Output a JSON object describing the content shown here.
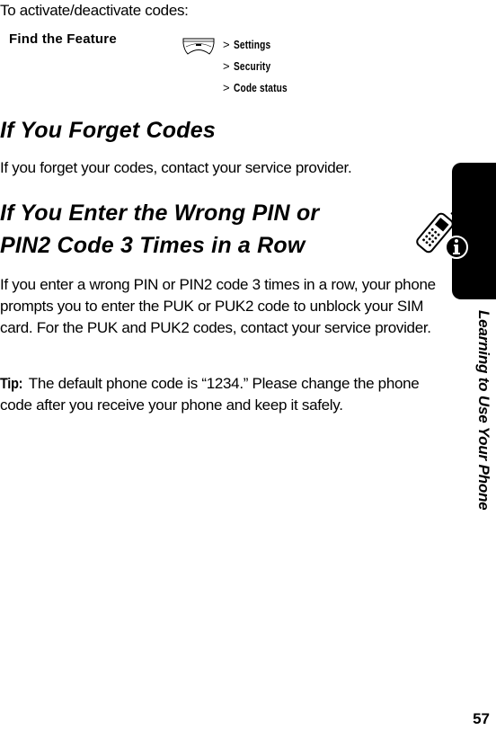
{
  "intro": "To activate/deactivate codes:",
  "find_feature": {
    "label": "Find the Feature",
    "key_icon": "menu-key-icon",
    "separator": ">",
    "path": [
      "Settings",
      "Security",
      "Code status"
    ]
  },
  "sections": [
    {
      "heading": "If You Forget Codes",
      "body": "If you forget your codes, contact your service provider."
    },
    {
      "heading_line1": "If You Enter the Wrong PIN or",
      "heading_line2": "PIN2 Code 3 Times in a Row",
      "body": "If you enter a wrong PIN or PIN2 code 3 times in a row, your phone prompts you to enter the PUK or PUK2 code to unblock your SIM card. For the PUK and PUK2 codes, contact your service provider."
    }
  ],
  "tip": {
    "label": "Tip:",
    "text": " The default phone code is “1234.” Please change the phone code after you receive your phone and keep it safely."
  },
  "side_tab": {
    "icon": "phone-info-icon",
    "title": "Learning to Use Your Phone"
  },
  "page_number": "57"
}
